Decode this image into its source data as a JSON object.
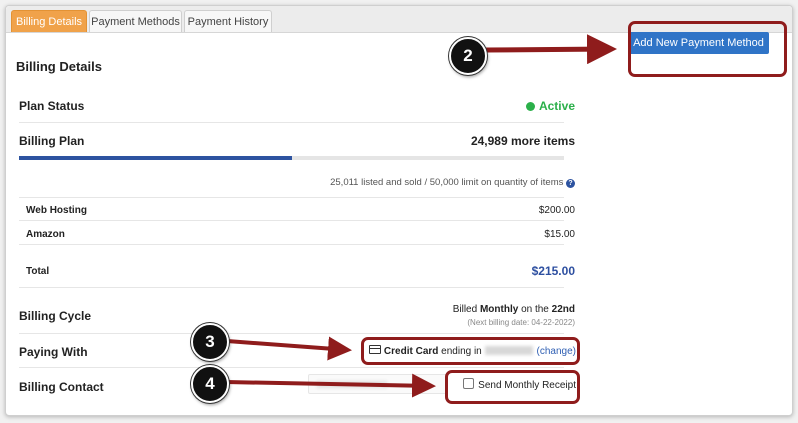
{
  "tabs": [
    {
      "label": "Billing Details"
    },
    {
      "label": "Payment Methods"
    },
    {
      "label": "Payment History"
    }
  ],
  "section_title": "Billing Details",
  "plan_status": {
    "label": "Plan Status",
    "value": "Active"
  },
  "billing_plan": {
    "label": "Billing Plan",
    "value": "24,989 more items",
    "progress_fraction": 0.5,
    "usage_text": "25,011 listed and sold / 50,000 limit on quantity of items"
  },
  "charges": [
    {
      "label": "Web Hosting",
      "amount": "$200.00"
    },
    {
      "label": "Amazon",
      "amount": "$15.00"
    }
  ],
  "total": {
    "label": "Total",
    "amount": "$215.00"
  },
  "billing_cycle": {
    "label": "Billing Cycle",
    "prefix": "Billed",
    "frequency": "Monthly",
    "on_the": "on the",
    "day": "22nd",
    "next_date": "(Next billing date: 04-22-2022)"
  },
  "paying_with": {
    "label": "Paying With",
    "method": "Credit Card",
    "ending_in": "ending in",
    "change_label": "(change)"
  },
  "billing_contact": {
    "label": "Billing Contact",
    "checkbox_label": "Send Monthly Receipt"
  },
  "add_payment_button": "Add New Payment Method",
  "annotations": [
    "2",
    "3",
    "4"
  ],
  "colors": {
    "accent": "#2f74c7",
    "annotation": "#8f1c1c",
    "active_tab": "#f0a24a",
    "status_active": "#2bb04a"
  }
}
